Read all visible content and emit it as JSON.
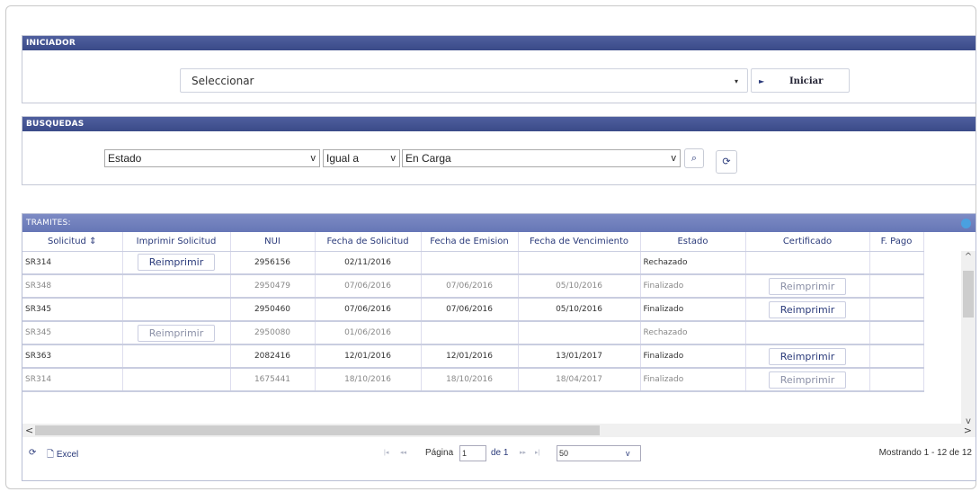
{
  "iniciador": {
    "title": "INICIADOR",
    "select_value": "Seleccionar",
    "caret": "▾",
    "button_label": "Iniciar",
    "play_icon": "►"
  },
  "busquedas": {
    "title": "BUSQUEDAS",
    "field": "Estado",
    "operator": "Igual a",
    "value": "En Carga",
    "chevron": "v",
    "search_icon": "⌕",
    "refresh_icon": "⟳"
  },
  "tramites": {
    "title": "TRAMITES:",
    "columns": [
      "Solicitud",
      "Imprimir Solicitud",
      "NUI",
      "Fecha de Solicitud",
      "Fecha de Emision",
      "Fecha de Vencimiento",
      "Estado",
      "Certificado",
      "F. Pago"
    ],
    "sort_icon": "⇕",
    "reimprimir": "Reimprimir",
    "rows": [
      {
        "solicitud": "SR314",
        "imprimir": "Reimprimir",
        "nui": "2956156",
        "fecha_solicitud": "02/11/2016",
        "fecha_emision": "",
        "fecha_vencimiento": "",
        "estado": "Rechazado",
        "certificado": ""
      },
      {
        "solicitud": "SR348",
        "imprimir": "",
        "nui": "2950479",
        "fecha_solicitud": "07/06/2016",
        "fecha_emision": "07/06/2016",
        "fecha_vencimiento": "05/10/2016",
        "estado": "Finalizado",
        "certificado": "Reimprimir"
      },
      {
        "solicitud": "SR345",
        "imprimir": "",
        "nui": "2950460",
        "fecha_solicitud": "07/06/2016",
        "fecha_emision": "07/06/2016",
        "fecha_vencimiento": "05/10/2016",
        "estado": "Finalizado",
        "certificado": "Reimprimir"
      },
      {
        "solicitud": "SR345",
        "imprimir": "Reimprimir",
        "nui": "2950080",
        "fecha_solicitud": "01/06/2016",
        "fecha_emision": "",
        "fecha_vencimiento": "",
        "estado": "Rechazado",
        "certificado": ""
      },
      {
        "solicitud": "SR363",
        "imprimir": "",
        "nui": "2082416",
        "fecha_solicitud": "12/01/2016",
        "fecha_emision": "12/01/2016",
        "fecha_vencimiento": "13/01/2017",
        "estado": "Finalizado",
        "certificado": "Reimprimir"
      },
      {
        "solicitud": "SR314",
        "imprimir": "",
        "nui": "1675441",
        "fecha_solicitud": "18/10/2016",
        "fecha_emision": "18/10/2016",
        "fecha_vencimiento": "18/04/2017",
        "estado": "Finalizado",
        "certificado": "Reimprimir"
      }
    ]
  },
  "pager": {
    "refresh_icon": "⟳",
    "excel_label": "Excel",
    "excel_icon": "🗋",
    "first": "|◂",
    "prev": "◂◂",
    "pagina_label": "Página",
    "page": "1",
    "of_label": "de 1",
    "next": "▸▸",
    "last": "▸|",
    "page_size": "50",
    "page_size_caret": "v",
    "showing": "Mostrando 1 - 12 de 12"
  },
  "scroll": {
    "up": "^",
    "down": "v",
    "left": "<",
    "right": ">"
  }
}
